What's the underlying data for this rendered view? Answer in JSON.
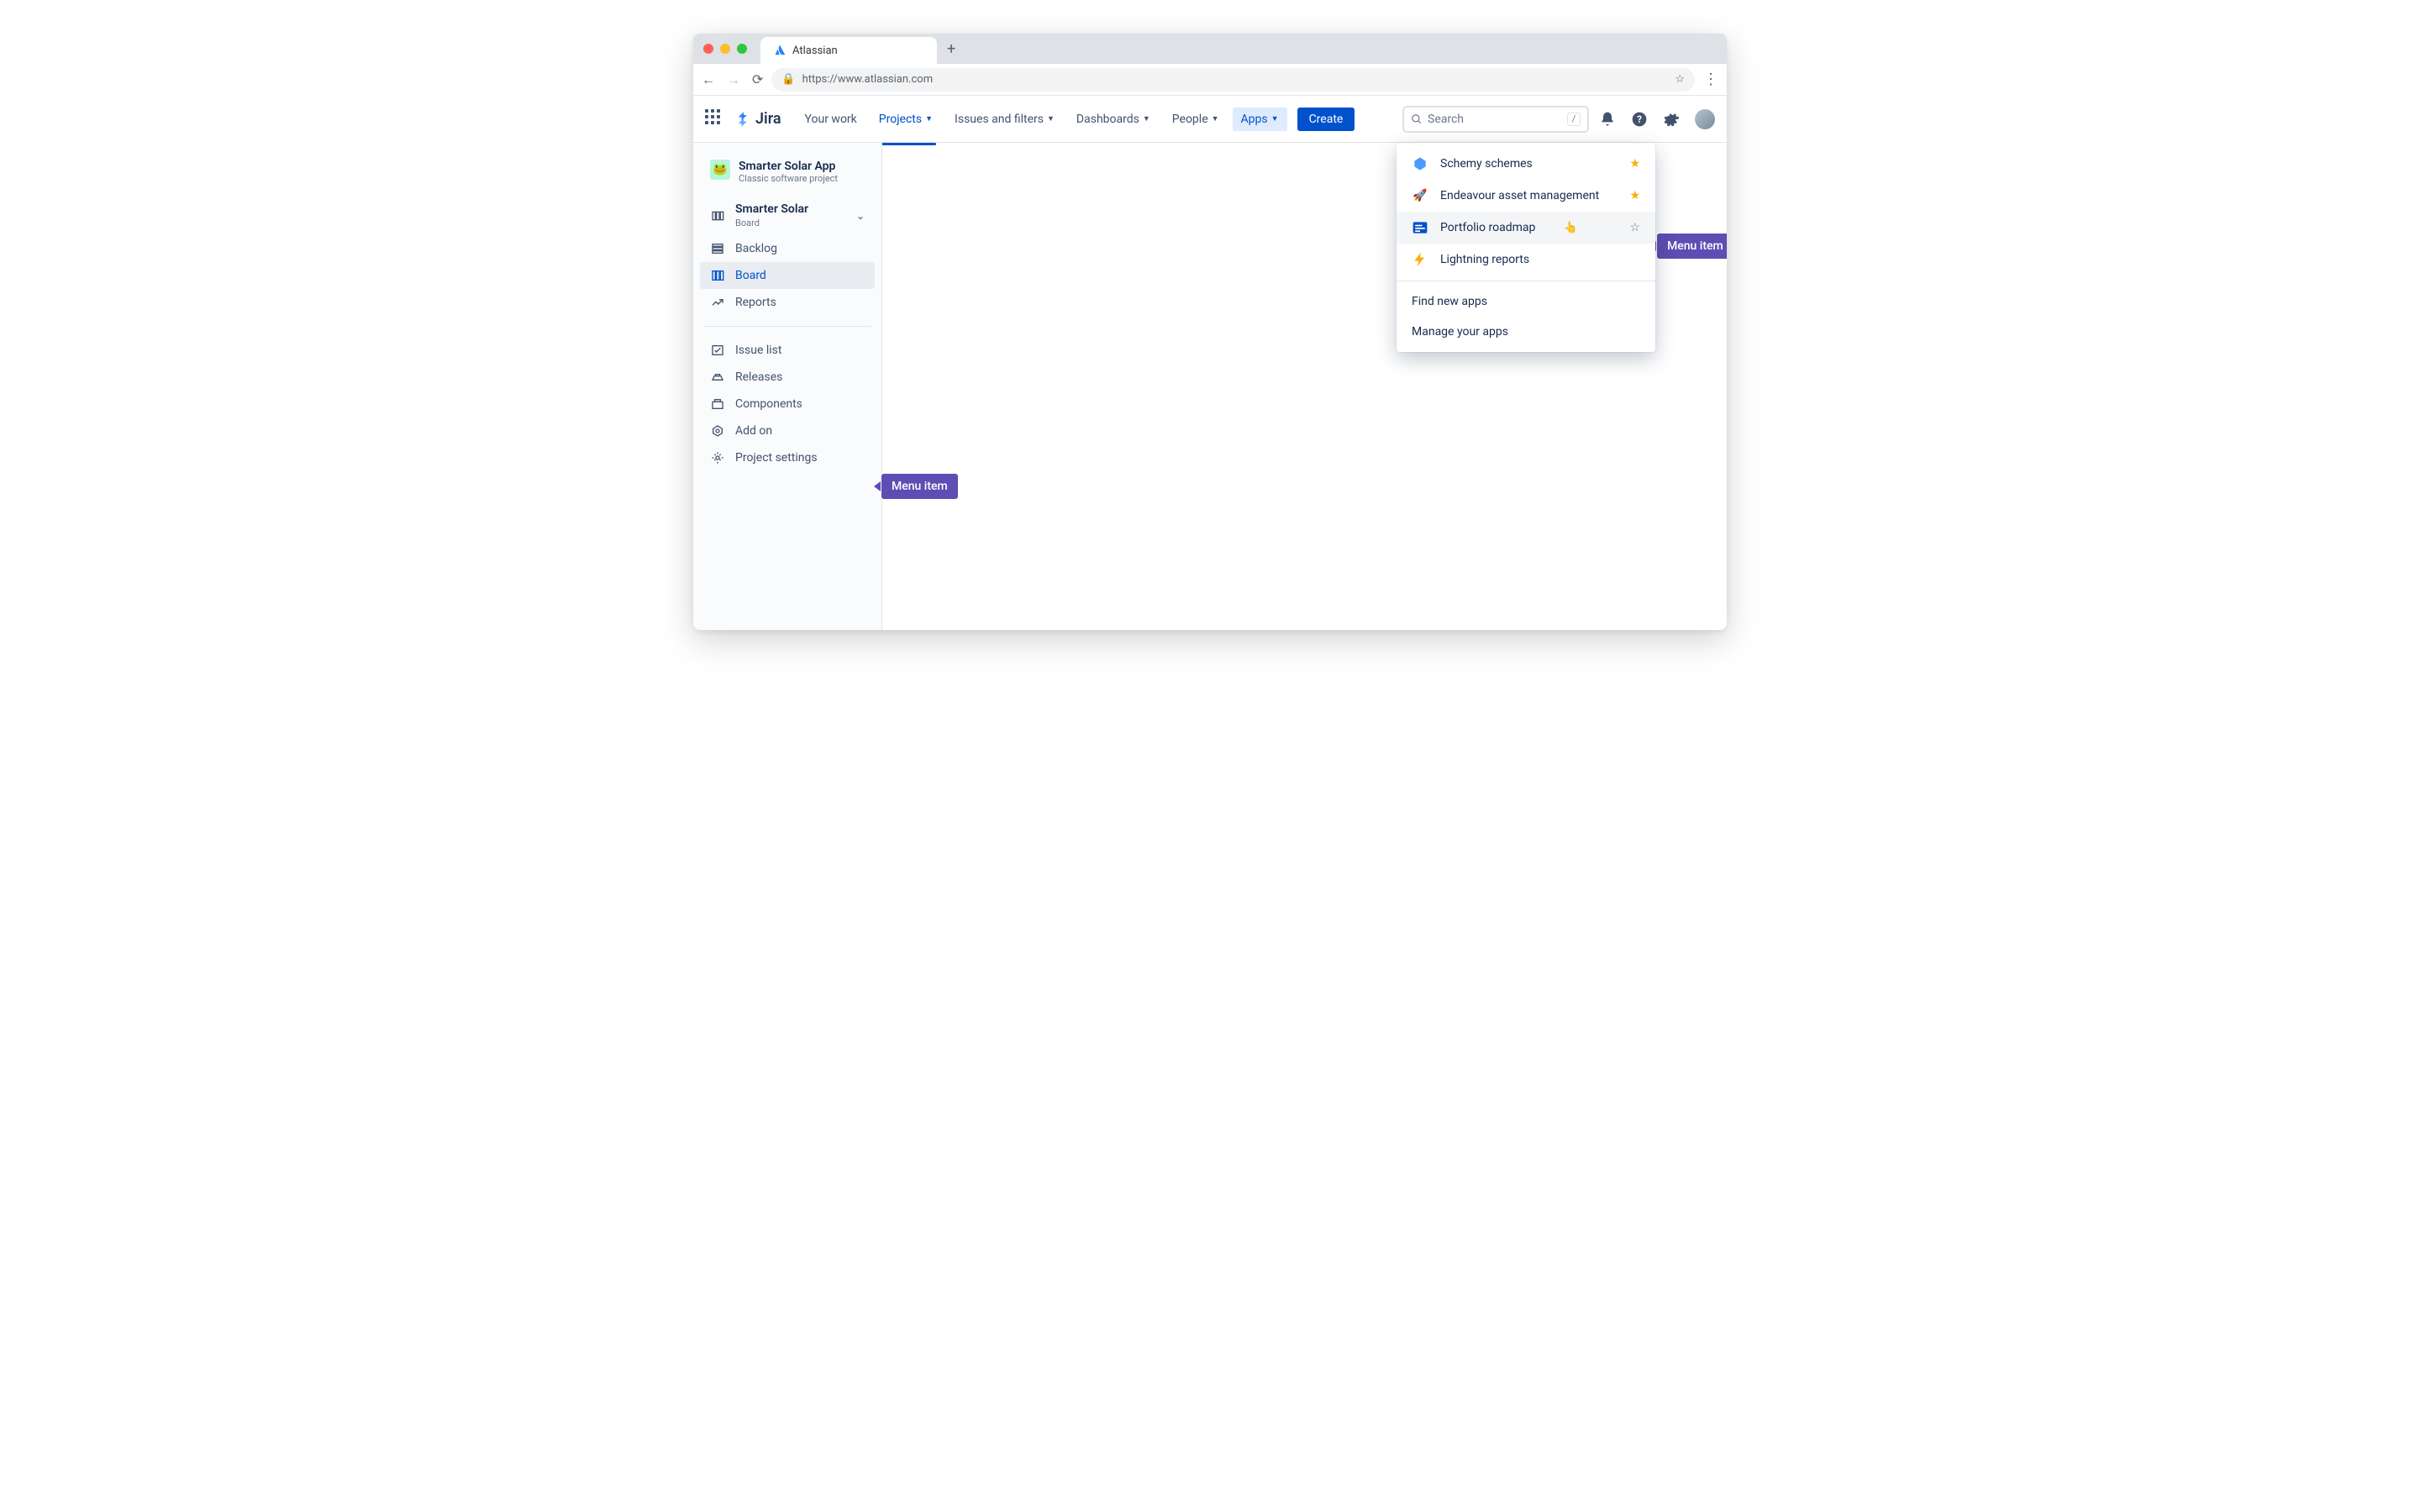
{
  "browser": {
    "tab_title": "Atlassian",
    "url": "https://www.atlassian.com"
  },
  "topnav": {
    "logo": "Jira",
    "items": [
      {
        "label": "Your work",
        "dropdown": false
      },
      {
        "label": "Projects",
        "dropdown": true,
        "active": true
      },
      {
        "label": "Issues and filters",
        "dropdown": true
      },
      {
        "label": "Dashboards",
        "dropdown": true
      },
      {
        "label": "People",
        "dropdown": true
      },
      {
        "label": "Apps",
        "dropdown": true,
        "open": true
      }
    ],
    "create": "Create",
    "search_placeholder": "Search",
    "search_key": "/"
  },
  "sidebar": {
    "project": {
      "name": "Smarter Solar App",
      "subtitle": "Classic software project"
    },
    "board": {
      "name": "Smarter Solar",
      "subtitle": "Board"
    },
    "nav": [
      {
        "icon": "backlog",
        "label": "Backlog"
      },
      {
        "icon": "board",
        "label": "Board",
        "selected": true
      },
      {
        "icon": "reports",
        "label": "Reports"
      }
    ],
    "nav2": [
      {
        "icon": "issuelist",
        "label": "Issue list"
      },
      {
        "icon": "releases",
        "label": "Releases"
      },
      {
        "icon": "components",
        "label": "Components"
      },
      {
        "icon": "addon",
        "label": "Add on"
      },
      {
        "icon": "settings",
        "label": "Project settings"
      }
    ]
  },
  "dropdown": {
    "items": [
      {
        "icon": "hex",
        "label": "Schemy schemes",
        "starred": true
      },
      {
        "icon": "rocket",
        "label": "Endeavour asset management",
        "starred": true
      },
      {
        "icon": "portfolio",
        "label": "Portfolio roadmap",
        "starred": false,
        "hover": true
      },
      {
        "icon": "lightning",
        "label": "Lightning reports",
        "starred": false,
        "nostar": true
      }
    ],
    "links": [
      "Find new apps",
      "Manage your apps"
    ]
  },
  "badges": {
    "menu_item": "Menu item"
  }
}
